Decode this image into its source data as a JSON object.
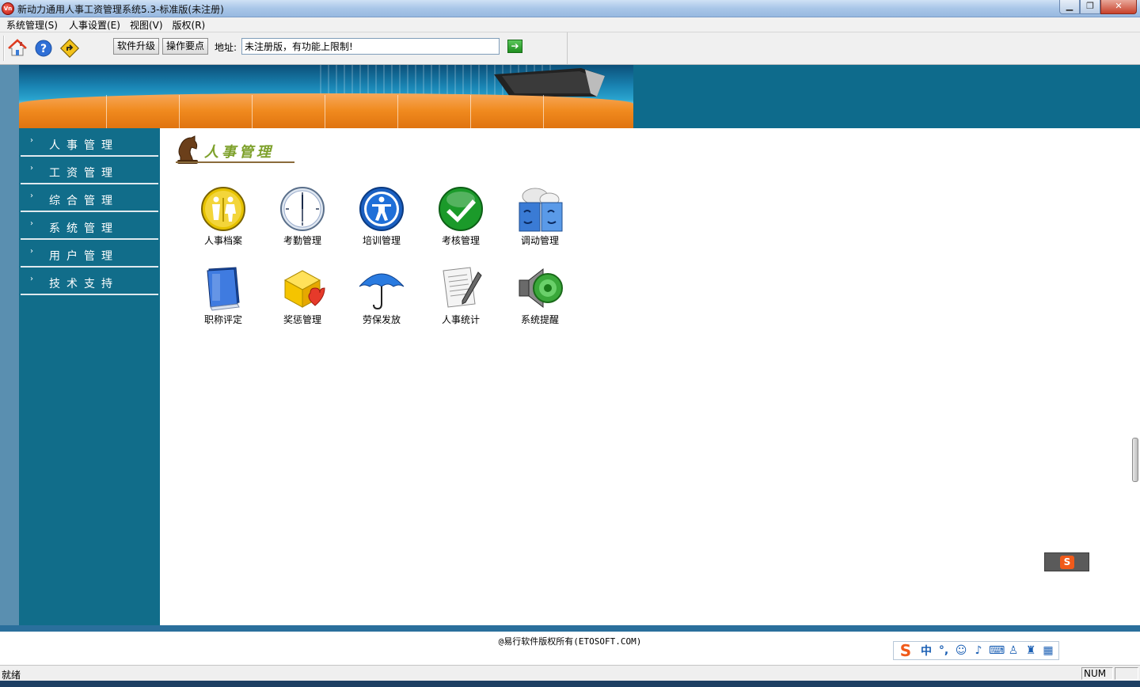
{
  "window": {
    "title": "新动力通用人事工资管理系统5.3-标准版(未注册)",
    "app_icon": "Vn"
  },
  "menu": [
    {
      "label": "系统管理(S)"
    },
    {
      "label": "人事设置(E)"
    },
    {
      "label": "视图(V)"
    },
    {
      "label": "版权(R)"
    }
  ],
  "toolbar": {
    "upgrade_label": "软件升级",
    "guide_label": "操作要点",
    "address_label": "地址:",
    "address_value": "未注册版，有功能上限制!"
  },
  "sidebar": {
    "items": [
      {
        "label": "人事管理"
      },
      {
        "label": "工资管理"
      },
      {
        "label": "综合管理"
      },
      {
        "label": "系统管理"
      },
      {
        "label": "用户管理"
      },
      {
        "label": "技术支持"
      }
    ]
  },
  "content": {
    "section_title": "人事管理",
    "icons": [
      {
        "label": "人事档案",
        "icon": "restroom-icon"
      },
      {
        "label": "考勤管理",
        "icon": "clock-icon"
      },
      {
        "label": "培训管理",
        "icon": "person-icon"
      },
      {
        "label": "考核管理",
        "icon": "checkmark-icon"
      },
      {
        "label": "调动管理",
        "icon": "faces-icon"
      },
      {
        "label": "职称评定",
        "icon": "book-icon"
      },
      {
        "label": "奖惩管理",
        "icon": "gift-heart-icon"
      },
      {
        "label": "劳保发放",
        "icon": "umbrella-icon"
      },
      {
        "label": "人事统计",
        "icon": "document-pen-icon"
      },
      {
        "label": "系统提醒",
        "icon": "speaker-icon"
      }
    ]
  },
  "footer": {
    "copyright": "@易行软件版权所有(ETOSOFT.COM)",
    "ime_chars": [
      "中",
      "°,"
    ]
  },
  "status": {
    "text": "就绪",
    "num": "NUM"
  },
  "colors": {
    "frame": "#0e6b8c",
    "banner_orange": "#f08a1e",
    "sidebar_bg": "#116d8a"
  }
}
